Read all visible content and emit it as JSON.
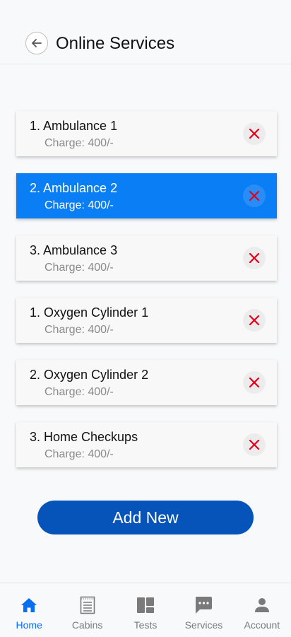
{
  "header": {
    "title": "Online Services",
    "back_icon": "arrow-left-icon"
  },
  "services": [
    {
      "name": "1. Ambulance 1",
      "charge": "Charge: 400/-",
      "selected": false
    },
    {
      "name": "2. Ambulance 2",
      "charge": "Charge: 400/-",
      "selected": true
    },
    {
      "name": "3. Ambulance 3",
      "charge": "Charge: 400/-",
      "selected": false
    },
    {
      "name": "1. Oxygen Cylinder 1",
      "charge": "Charge: 400/-",
      "selected": false
    },
    {
      "name": "2. Oxygen Cylinder 2",
      "charge": "Charge: 400/-",
      "selected": false
    },
    {
      "name": "3. Home Checkups",
      "charge": "Charge: 400/-",
      "selected": false
    }
  ],
  "add_button": {
    "label": "Add New"
  },
  "bottom_nav": [
    {
      "label": "Home",
      "icon": "home-icon",
      "active": true
    },
    {
      "label": "Cabins",
      "icon": "document-icon",
      "active": false
    },
    {
      "label": "Tests",
      "icon": "dashboard-icon",
      "active": false
    },
    {
      "label": "Services",
      "icon": "chat-icon",
      "active": false
    },
    {
      "label": "Account",
      "icon": "person-icon",
      "active": false
    }
  ],
  "colors": {
    "accent": "#0a7ff5",
    "button": "#0654b9",
    "remove_icon": "#e3001b",
    "nav_active": "#0a6ef0",
    "nav_inactive": "#7a7a7a"
  }
}
